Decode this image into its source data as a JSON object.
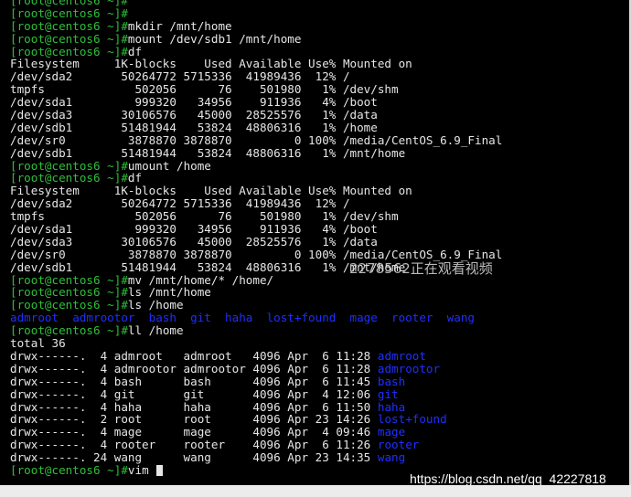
{
  "terminal": {
    "lines": [
      {
        "prompt": "[root@centos6 ~]#",
        "cmd": ""
      },
      {
        "prompt": "[root@centos6 ~]#",
        "cmd": ""
      },
      {
        "prompt": "[root@centos6 ~]#",
        "cmd": "mkdir /mnt/home"
      },
      {
        "prompt": "[root@centos6 ~]#",
        "cmd": "mount /dev/sdb1 /mnt/home"
      },
      {
        "prompt": "[root@centos6 ~]#",
        "cmd": "df"
      },
      {
        "text": "Filesystem     1K-blocks    Used Available Use% Mounted on"
      },
      {
        "text": "/dev/sda2       50264772 5715336  41989436  12% /"
      },
      {
        "text": "tmpfs             502056      76    501980   1% /dev/shm"
      },
      {
        "text": "/dev/sda1         999320   34956    911936   4% /boot"
      },
      {
        "text": "/dev/sda3       30106576   45000  28525576   1% /data"
      },
      {
        "text": "/dev/sdb1       51481944   53824  48806316   1% /home"
      },
      {
        "text": "/dev/sr0         3878870 3878870         0 100% /media/CentOS_6.9_Final"
      },
      {
        "text": "/dev/sdb1       51481944   53824  48806316   1% /mnt/home"
      },
      {
        "prompt": "[root@centos6 ~]#",
        "cmd": "umount /home"
      },
      {
        "prompt": "[root@centos6 ~]#",
        "cmd": "df"
      },
      {
        "text": "Filesystem     1K-blocks    Used Available Use% Mounted on"
      },
      {
        "text": "/dev/sda2       50264772 5715336  41989436  12% /"
      },
      {
        "text": "tmpfs             502056      76    501980   1% /dev/shm"
      },
      {
        "text": "/dev/sda1         999320   34956    911936   4% /boot"
      },
      {
        "text": "/dev/sda3       30106576   45000  28525576   1% /data"
      },
      {
        "text": "/dev/sr0         3878870 3878870         0 100% /media/CentOS_6.9_Final"
      },
      {
        "text": "/dev/sdb1       51481944   53824  48806316   1% /mnt/home"
      },
      {
        "prompt": "[root@centos6 ~]#",
        "cmd": "mv /mnt/home/* /home/"
      },
      {
        "prompt": "[root@centos6 ~]#",
        "cmd": "ls /mnt/home"
      },
      {
        "prompt": "[root@centos6 ~]#",
        "cmd": "ls /home"
      },
      {
        "blue": "admroot  admrootor  bash  git  haha  lost+found  mage  rooter  wang"
      },
      {
        "prompt": "[root@centos6 ~]#",
        "cmd": "ll /home"
      },
      {
        "text": "total 36"
      },
      {
        "text": "drwx------.  4 admroot   admroot   4096 Apr  6 11:28 ",
        "blue": "admroot"
      },
      {
        "text": "drwx------.  4 admrootor admrootor 4096 Apr  6 11:28 ",
        "blue": "admrootor"
      },
      {
        "text": "drwx------.  4 bash      bash      4096 Apr  6 11:45 ",
        "blue": "bash"
      },
      {
        "text": "drwx------.  4 git       git       4096 Apr  4 12:06 ",
        "blue": "git"
      },
      {
        "text": "drwx------.  4 haha      haha      4096 Apr  6 11:50 ",
        "blue": "haha"
      },
      {
        "text": "drwx------.  2 root      root      4096 Apr 23 14:26 ",
        "blue": "lost+found"
      },
      {
        "text": "drwx------.  4 mage      mage      4096 Apr  4 09:46 ",
        "blue": "mage"
      },
      {
        "text": "drwx------.  4 rooter    rooter    4096 Apr  6 11:26 ",
        "blue": "rooter"
      },
      {
        "text": "drwx------. 24 wang      wang      4096 Apr 23 14:35 ",
        "blue": "wang"
      },
      {
        "prompt": "[root@centos6 ~]#",
        "cmd": "vim ",
        "cursor": true
      }
    ]
  },
  "overlay_text": "2278562正在观看视频",
  "watermark": "https://blog.csdn.net/qq_42227818",
  "colors": {
    "background": "#000000",
    "text": "#e6e6e6",
    "prompt": "#2fbf3a",
    "directory": "#1f2fff"
  }
}
